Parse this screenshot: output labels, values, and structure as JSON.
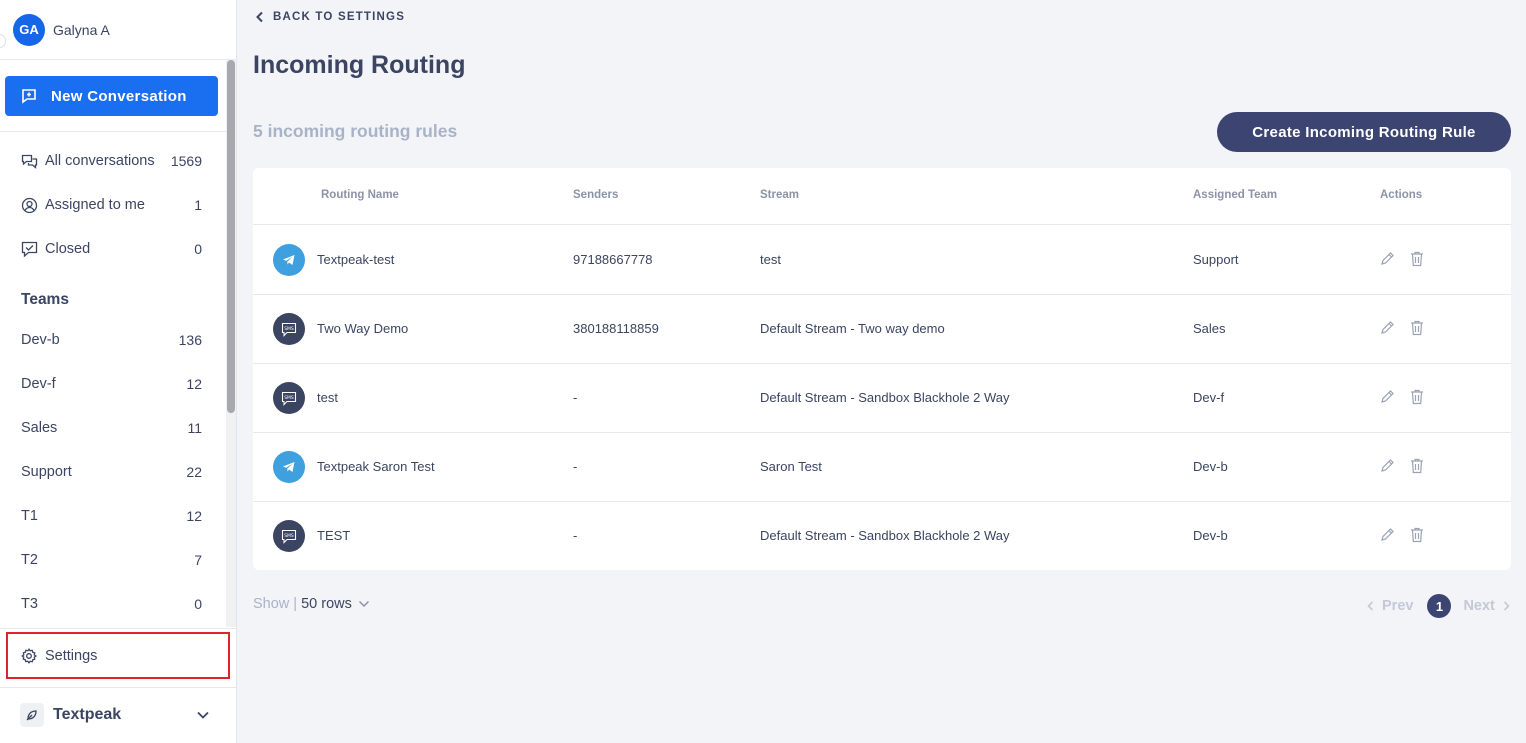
{
  "user": {
    "initials": "GA",
    "name": "Galyna A"
  },
  "sidebar": {
    "new_conversation": "New Conversation",
    "nav": [
      {
        "label": "All conversations",
        "count": "1569",
        "icon": "chat-bubbles-icon"
      },
      {
        "label": "Assigned to me",
        "count": "1",
        "icon": "user-circle-icon"
      },
      {
        "label": "Closed",
        "count": "0",
        "icon": "chat-check-icon"
      }
    ],
    "teams_title": "Teams",
    "teams": [
      {
        "label": "Dev-b",
        "count": "136"
      },
      {
        "label": "Dev-f",
        "count": "12"
      },
      {
        "label": "Sales",
        "count": "11"
      },
      {
        "label": "Support",
        "count": "22"
      },
      {
        "label": "T1",
        "count": "12"
      },
      {
        "label": "T2",
        "count": "7"
      },
      {
        "label": "T3",
        "count": "0"
      }
    ],
    "settings": "Settings",
    "org": "Textpeak"
  },
  "main": {
    "back_label": "BACK TO SETTINGS",
    "title": "Incoming Routing",
    "rule_count": "5 incoming routing rules",
    "create_button": "Create Incoming Routing Rule",
    "table": {
      "headers": [
        "Routing Name",
        "Senders",
        "Stream",
        "Assigned Team",
        "Actions"
      ],
      "rows": [
        {
          "channel": "telegram",
          "name": "Textpeak-test",
          "senders": "97188667778",
          "stream": "test",
          "team": "Support"
        },
        {
          "channel": "sms",
          "name": "Two Way Demo",
          "senders": "380188118859",
          "stream": "Default Stream - Two way demo",
          "team": "Sales"
        },
        {
          "channel": "sms",
          "name": "test",
          "senders": "-",
          "stream": "Default Stream - Sandbox Blackhole 2 Way",
          "team": "Dev-f"
        },
        {
          "channel": "telegram",
          "name": "Textpeak Saron Test",
          "senders": "-",
          "stream": "Saron Test",
          "team": "Dev-b"
        },
        {
          "channel": "sms",
          "name": "TEST",
          "senders": "-",
          "stream": "Default Stream - Sandbox Blackhole 2 Way",
          "team": "Dev-b"
        }
      ]
    },
    "show_label": "Show |",
    "rows_option": "50 rows",
    "pagination": {
      "prev": "Prev",
      "page": "1",
      "next": "Next"
    }
  },
  "colors": {
    "primary": "#1a6ff0",
    "navy": "#3c4571",
    "highlight": "#e0222a",
    "telegram": "#3fa0e0"
  }
}
